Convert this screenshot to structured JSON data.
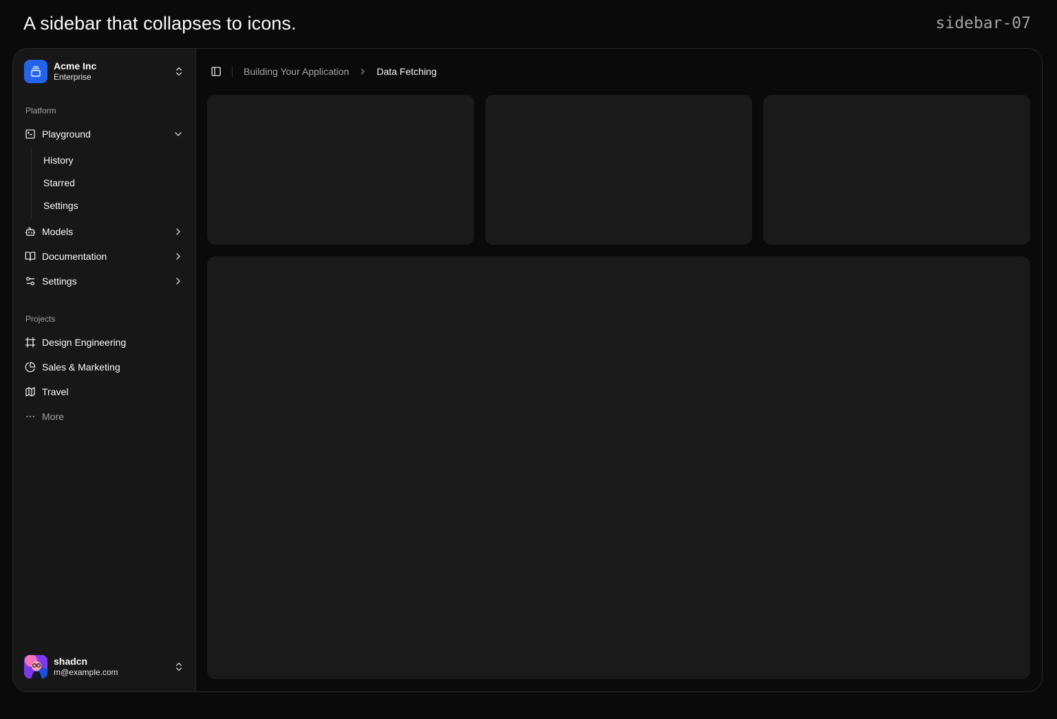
{
  "header": {
    "title": "A sidebar that collapses to icons.",
    "slug": "sidebar-07"
  },
  "team": {
    "name": "Acme Inc",
    "plan": "Enterprise",
    "logo_icon": "gallery-vertical-end-icon",
    "logo_color": "#2563eb"
  },
  "sidebar": {
    "platform_label": "Platform",
    "platform_items": [
      {
        "label": "Playground",
        "icon": "square-terminal-icon",
        "expanded": true,
        "children": [
          "History",
          "Starred",
          "Settings"
        ]
      },
      {
        "label": "Models",
        "icon": "bot-icon"
      },
      {
        "label": "Documentation",
        "icon": "book-open-icon"
      },
      {
        "label": "Settings",
        "icon": "settings-2-icon"
      }
    ],
    "projects_label": "Projects",
    "project_items": [
      {
        "label": "Design Engineering",
        "icon": "frame-icon"
      },
      {
        "label": "Sales & Marketing",
        "icon": "pie-chart-icon"
      },
      {
        "label": "Travel",
        "icon": "map-icon"
      }
    ],
    "more_label": "More"
  },
  "user": {
    "name": "shadcn",
    "email": "m@example.com"
  },
  "breadcrumb": {
    "parent": "Building Your Application",
    "current": "Data Fetching"
  },
  "colors": {
    "background": "#0a0a0a",
    "sidebar": "#171717",
    "card": "#1a1a1a",
    "accent": "#2563eb"
  }
}
